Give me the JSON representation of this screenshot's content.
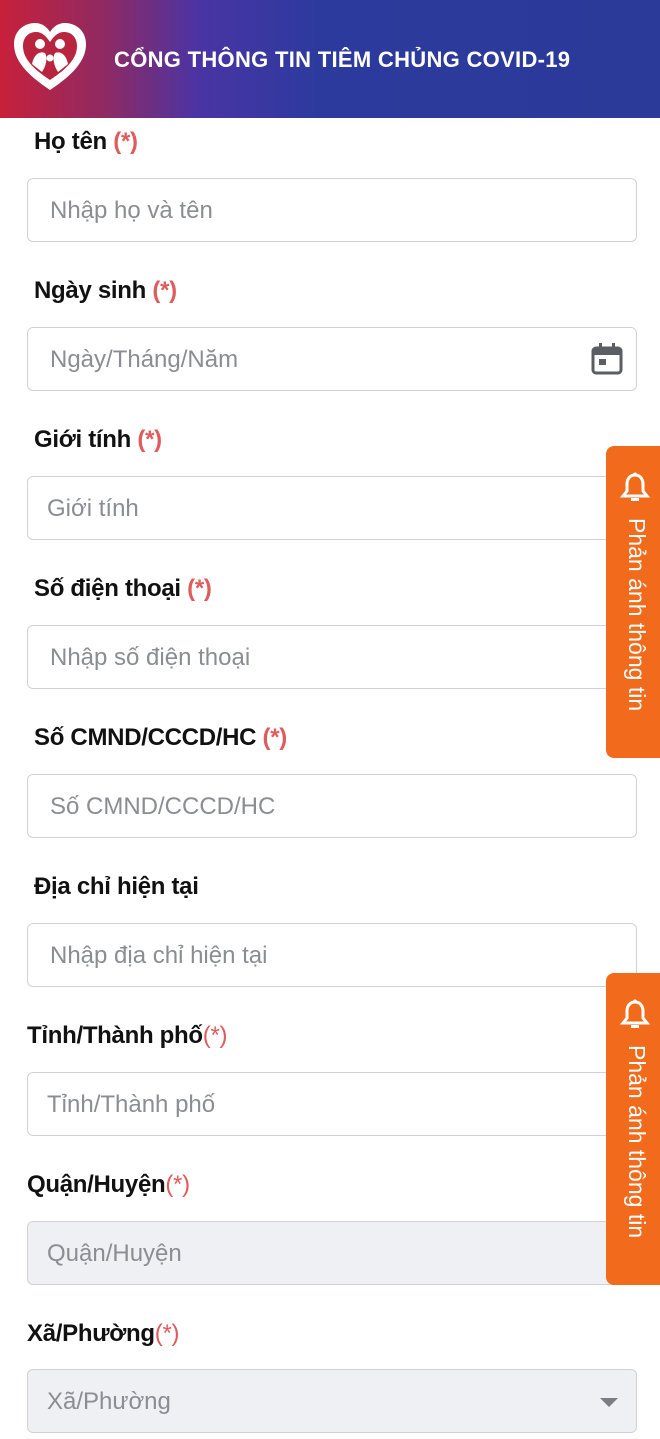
{
  "header": {
    "title": "CỔNG THÔNG TIN TIÊM CHỦNG COVID-19",
    "logo_icon": "heart-people-logo"
  },
  "required_mark": "(*)",
  "form": {
    "fullname": {
      "label": "Họ tên",
      "placeholder": "Nhập họ và tên"
    },
    "dob": {
      "label": "Ngày sinh",
      "placeholder": "Ngày/Tháng/Năm",
      "icon": "calendar-icon"
    },
    "gender": {
      "label": "Giới tính",
      "placeholder": "Giới tính"
    },
    "phone": {
      "label": "Số điện thoại",
      "placeholder": "Nhập số điện thoại"
    },
    "id_number": {
      "label": "Số CMND/CCCD/HC",
      "placeholder": "Số CMND/CCCD/HC"
    },
    "address": {
      "label": "Địa chỉ hiện tại",
      "placeholder": "Nhập địa chỉ hiện tại"
    },
    "province": {
      "label": "Tỉnh/Thành phố",
      "placeholder": "Tỉnh/Thành phố"
    },
    "district": {
      "label": "Quận/Huyện",
      "placeholder": "Quận/Huyện"
    },
    "ward": {
      "label": "Xã/Phường",
      "placeholder": "Xã/Phường"
    }
  },
  "feedback_tab": {
    "label": "Phản ánh thông tin",
    "icon": "bell-feedback-icon"
  },
  "colors": {
    "accent_orange": "#f26a1b",
    "required_red": "#e05b5b",
    "header_start": "#c8203b",
    "header_end": "#2b3a98"
  }
}
